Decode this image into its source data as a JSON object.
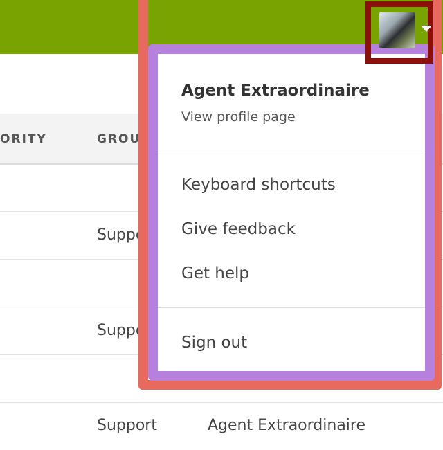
{
  "table": {
    "columns": [
      "ORITY",
      "GROU"
    ],
    "rows": [
      {
        "group": ""
      },
      {
        "group": "Suppo"
      },
      {
        "group": ""
      },
      {
        "group": "Suppo"
      },
      {
        "group": ""
      },
      {
        "group": "Support",
        "assignee": "Agent Extraordinaire"
      }
    ]
  },
  "user_menu": {
    "name": "Agent Extraordinaire",
    "profile_link": "View profile page",
    "items": [
      "Keyboard shortcuts",
      "Give feedback",
      "Get help"
    ],
    "sign_out": "Sign out"
  },
  "icons": {
    "avatar": "user-avatar",
    "caret": "caret-down-icon"
  },
  "colors": {
    "header": "#78a300",
    "annotation_outer": "#e86a5e",
    "annotation_inner": "#b680dd",
    "annotation_avatar": "#8b0f0a"
  }
}
